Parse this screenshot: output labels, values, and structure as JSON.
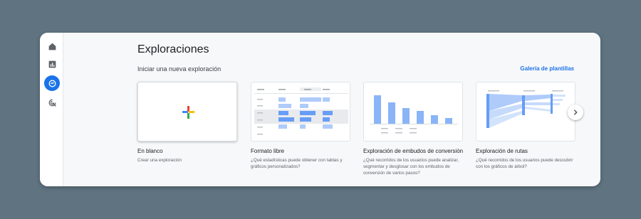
{
  "colors": {
    "accent": "#1a73e8",
    "chart_blue": "#8ab4f8",
    "chart_blue_dark": "#669df6"
  },
  "sidebar": {
    "items": [
      {
        "icon": "home-icon"
      },
      {
        "icon": "reports-icon"
      },
      {
        "icon": "explore-icon",
        "active": true
      },
      {
        "icon": "advertising-icon"
      }
    ]
  },
  "page": {
    "title": "Exploraciones",
    "subtitle": "Iniciar una nueva exploración",
    "gallery_link": "Galería de plantillas"
  },
  "templates": [
    {
      "name": "En blanco",
      "description": "Crear una exploración"
    },
    {
      "name": "Formato libre",
      "description": "¿Qué estadísticas puede obtener con tablas y gráficos personalizados?"
    },
    {
      "name": "Exploración de embudos de conversión",
      "description": "¿Qué recorridos de los usuarios puede analizar, segmentar y desglosar con los embudos de conversión de varios pasos?"
    },
    {
      "name": "Exploración de rutas",
      "description": "¿Qué recorridos de los usuarios puede descubrir con los gráficos de árbol?"
    }
  ],
  "carousel": {
    "next_icon": "chevron-right-icon"
  }
}
